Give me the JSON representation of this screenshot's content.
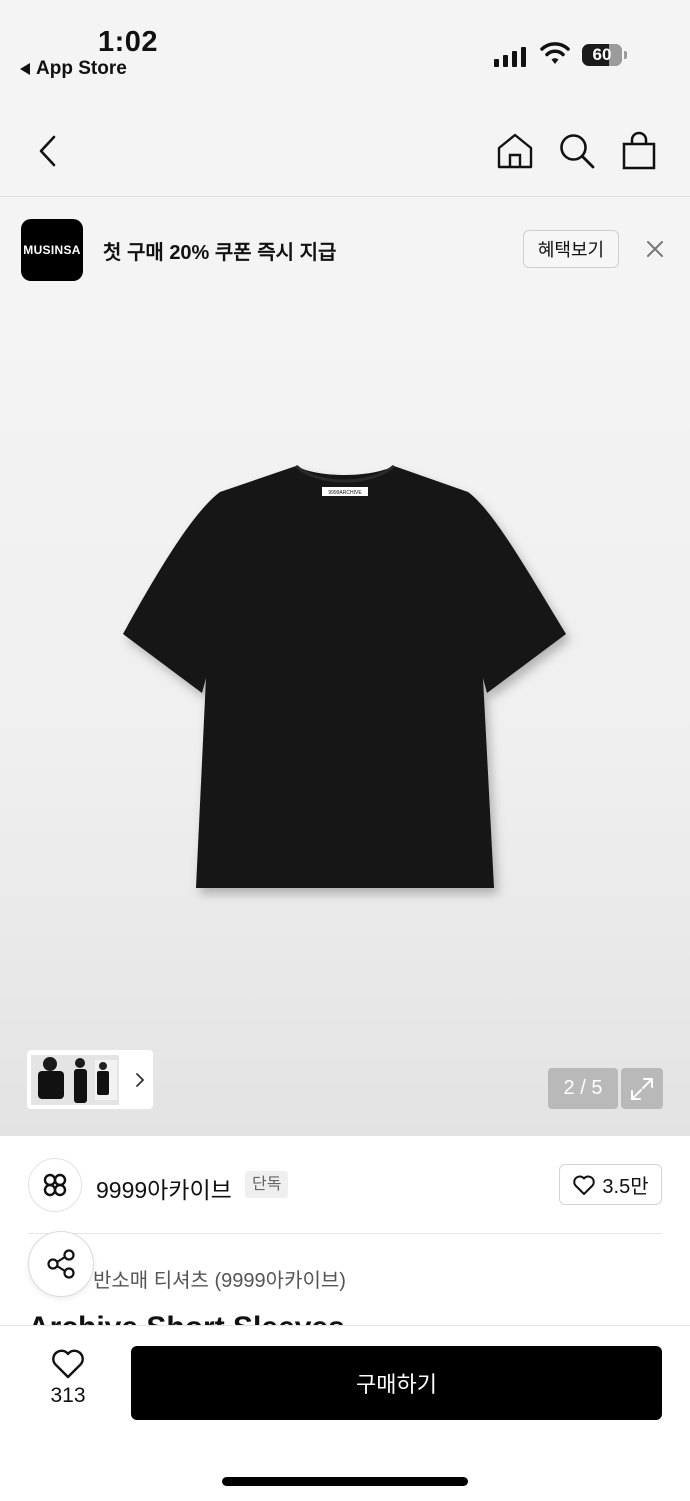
{
  "status_bar": {
    "time": "1:02",
    "back_app": "App Store",
    "battery": "60"
  },
  "nav": {
    "back": "chevron-left-icon",
    "home": "home-icon",
    "search": "search-icon",
    "bag": "shopping-bag-icon"
  },
  "promo": {
    "logo_text": "MUSINSA",
    "text": "첫 구매 20% 쿠폰 즉시 지급",
    "button": "혜택보기"
  },
  "product_image": {
    "label_text": "9999ARCHIVE",
    "counter": "2 / 5"
  },
  "brand": {
    "name": "9999아카이브",
    "tag": "단독",
    "likes": "3.5만"
  },
  "product": {
    "subtitle": "반소매 티셔츠 (9999아카이브)",
    "title": "Archive Short Sleeves"
  },
  "bottom_bar": {
    "wish_count": "313",
    "buy_label": "구매하기"
  },
  "colors": {
    "accent": "#000000",
    "background": "#f4f4f4"
  }
}
